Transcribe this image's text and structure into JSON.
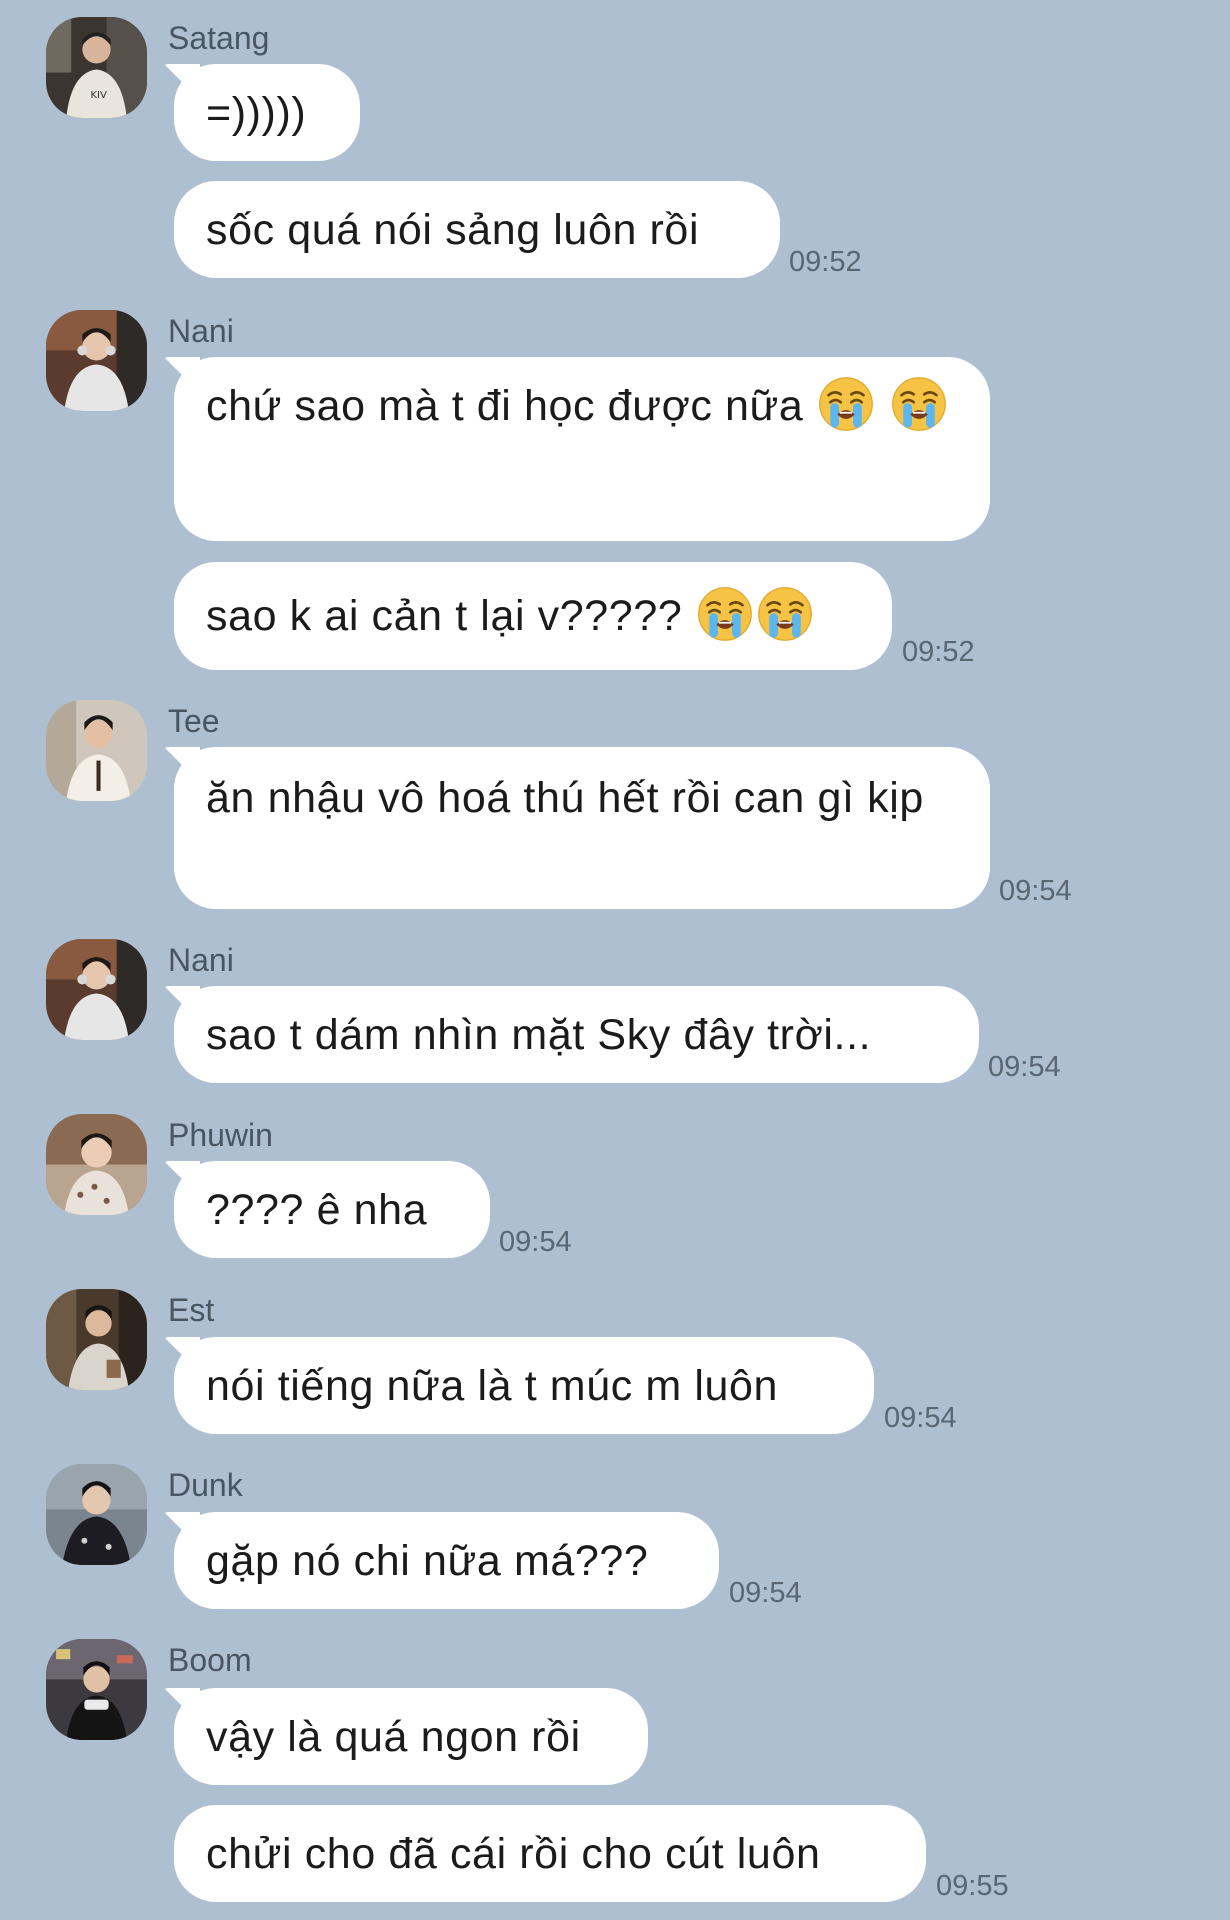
{
  "messages": [
    {
      "sender": "Satang",
      "avatar": "avatar-satang",
      "lines": [
        "=)))))",
        "sốc quá nói sảng luôn rồi"
      ],
      "time": "09:52"
    },
    {
      "sender": "Nani",
      "avatar": "avatar-nani",
      "lines": [
        "chứ sao mà t đi học được nữa",
        "sao k ai cản t lại v?????"
      ],
      "time": "09:52"
    },
    {
      "sender": "Tee",
      "avatar": "avatar-tee",
      "lines": [
        "ăn nhậu vô hoá thú hết rồi can gì kịp"
      ],
      "time": "09:54"
    },
    {
      "sender": "Nani",
      "avatar": "avatar-nani",
      "lines": [
        "sao t dám nhìn mặt Sky đây trời..."
      ],
      "time": "09:54"
    },
    {
      "sender": "Phuwin",
      "avatar": "avatar-phuwin",
      "lines": [
        "???? ê nha"
      ],
      "time": "09:54"
    },
    {
      "sender": "Est",
      "avatar": "avatar-est",
      "lines": [
        "nói tiếng nữa là t múc m luôn"
      ],
      "time": "09:54"
    },
    {
      "sender": "Dunk",
      "avatar": "avatar-dunk",
      "lines": [
        "gặp nó chi nữa má???"
      ],
      "time": "09:54"
    },
    {
      "sender": "Boom",
      "avatar": "avatar-boom",
      "lines": [
        "vậy là quá ngon rồi",
        "chửi cho đã cái rồi cho cút luôn"
      ],
      "time": "09:55"
    }
  ],
  "emoji": "loudly-crying-face",
  "colors": {
    "background": "#aebfd1",
    "bubble": "#ffffff",
    "text": "#1b1b1b",
    "meta": "#5a6674"
  }
}
